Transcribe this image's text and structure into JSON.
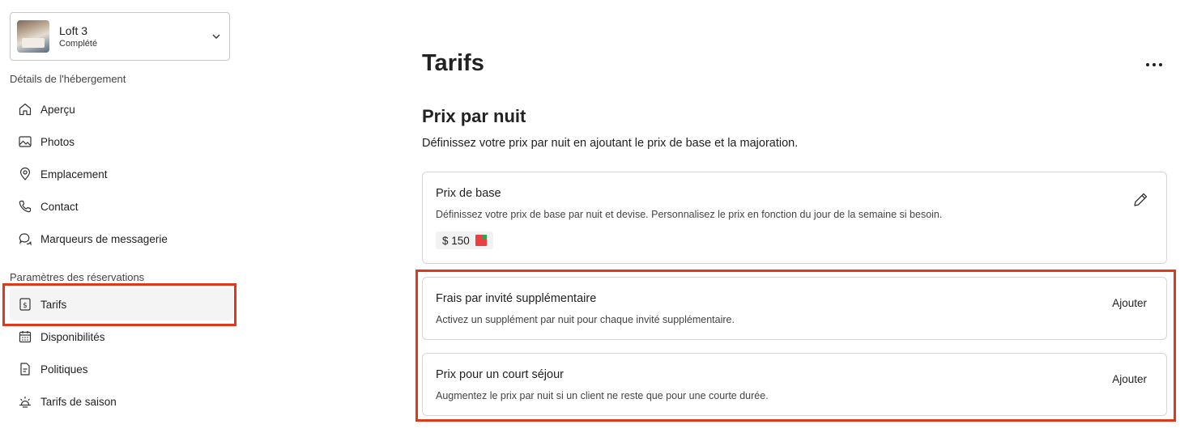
{
  "listing": {
    "name": "Loft 3",
    "status": "Complété"
  },
  "sidebar": {
    "section1_label": "Détails de l'hébergement",
    "section1_items": [
      {
        "label": "Aperçu",
        "icon": "home-icon"
      },
      {
        "label": "Photos",
        "icon": "image-icon"
      },
      {
        "label": "Emplacement",
        "icon": "location-pin-icon"
      },
      {
        "label": "Contact",
        "icon": "phone-icon"
      },
      {
        "label": "Marqueurs de messagerie",
        "icon": "chat-bubbles-icon"
      }
    ],
    "section2_label": "Paramètres des réservations",
    "section2_items": [
      {
        "label": "Tarifs",
        "icon": "price-tag-icon",
        "active": true
      },
      {
        "label": "Disponibilités",
        "icon": "calendar-icon"
      },
      {
        "label": "Politiques",
        "icon": "document-icon"
      },
      {
        "label": "Tarifs de saison",
        "icon": "sun-icon"
      }
    ]
  },
  "main": {
    "title": "Tarifs",
    "section_title": "Prix par nuit",
    "section_desc": "Définissez votre prix par nuit en ajoutant le prix de base et la majoration.",
    "base_price": {
      "title": "Prix de base",
      "desc": "Définissez votre prix de base par nuit et devise. Personnalisez le prix en fonction du jour de la semaine si besoin.",
      "value": "$ 150"
    },
    "extra_guest": {
      "title": "Frais par invité supplémentaire",
      "desc": "Activez un supplément par nuit pour chaque invité supplémentaire.",
      "action": "Ajouter"
    },
    "short_stay": {
      "title": "Prix pour un court séjour",
      "desc": "Augmentez le prix par nuit si un client ne reste que pour une courte durée.",
      "action": "Ajouter"
    }
  },
  "colors": {
    "highlight": "#e0381b",
    "active_bg": "#f4f4f4"
  }
}
